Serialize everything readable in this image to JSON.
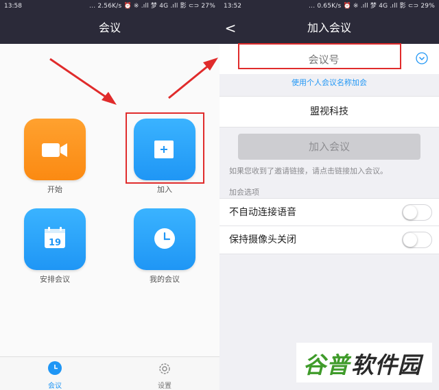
{
  "left": {
    "status": {
      "time": "13:58",
      "indicators": "... 2.56K/s ⏰ ※ .ıll 梦 4G .ıll 影 ⊂⊃ 27%"
    },
    "nav": {
      "title": "会议"
    },
    "tiles": {
      "start": {
        "label": "开始"
      },
      "join": {
        "label": "加入"
      },
      "schedule": {
        "label": "安排会议",
        "calendar_day": "19"
      },
      "my_meetings": {
        "label": "我的会议"
      }
    },
    "tabbar": {
      "meetings": {
        "label": "会议"
      },
      "settings": {
        "label": "设置"
      }
    }
  },
  "right": {
    "status": {
      "time": "13:52",
      "indicators": "... 0.65K/s ⏰ ※ .ıll 梦 4G .ıll 影 ⊂⊃ 29%"
    },
    "nav": {
      "title": "加入会议",
      "back_icon": "<"
    },
    "meeting_id_placeholder": "会议号",
    "use_personal_link": "使用个人会议名称加会",
    "name_value": "盟视科技",
    "join_button": "加入会议",
    "hint": "如果您收到了邀请链接，请点击链接加入会议。",
    "options_header": "加会选项",
    "options": [
      {
        "label": "不自动连接语音"
      },
      {
        "label": "保持摄像头关闭"
      }
    ]
  },
  "watermark": {
    "part1": "谷普",
    "part2": "软件园"
  },
  "colors": {
    "navbar": "#2b2a39",
    "blue": "#1f96f5",
    "orange": "#fb8a12",
    "annotation_red": "#e02b2b",
    "watermark_green": "#3f9b2a"
  }
}
